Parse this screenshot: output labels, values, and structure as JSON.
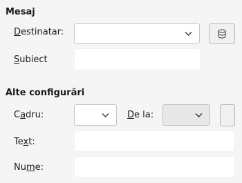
{
  "mesaj": {
    "heading": "Mesaj",
    "destinatar_label_accel": "D",
    "destinatar_label_rest": "estinatar:",
    "destinatar_value": "",
    "subiect_label_accel": "S",
    "subiect_label_rest": "ubiect",
    "subiect_value": ""
  },
  "alte": {
    "heading": "Alte configurări",
    "cadru_label_pre": "C",
    "cadru_label_accel": "a",
    "cadru_label_rest": "dru:",
    "cadru_value": "",
    "dela_label_accel": "D",
    "dela_label_rest": "e la:",
    "dela_value": "",
    "text_label_pre": "Te",
    "text_label_accel": "x",
    "text_label_rest": "t:",
    "text_value": "",
    "nume_label_pre": "Nu",
    "nume_label_accel": "m",
    "nume_label_rest": "e:",
    "nume_value": ""
  },
  "icons": {
    "address_book": "database-icon",
    "dropdown": "chevron-down-icon"
  }
}
